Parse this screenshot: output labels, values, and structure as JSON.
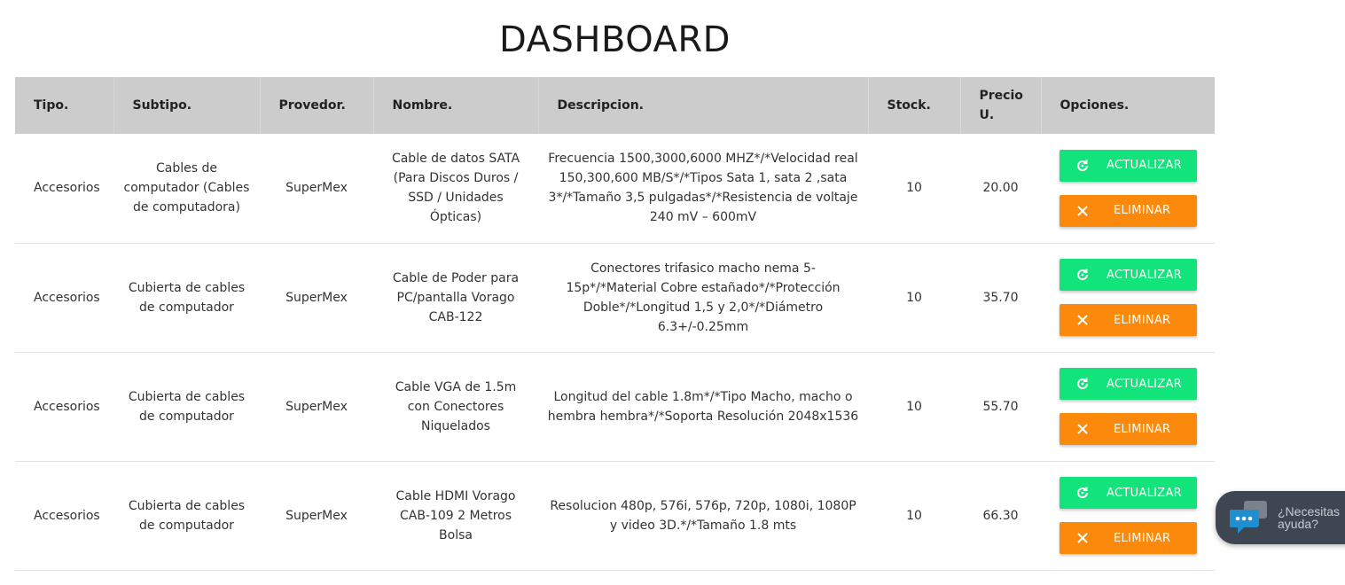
{
  "page": {
    "title": "DASHBOARD"
  },
  "table": {
    "headers": {
      "tipo": "Tipo.",
      "subtipo": "Subtipo.",
      "proveedor": "Provedor.",
      "nombre": "Nombre.",
      "descripcion": "Descripcion.",
      "stock": "Stock.",
      "precio": "Precio U.",
      "opciones": "Opciones."
    },
    "rows": [
      {
        "tipo": "Accesorios",
        "subtipo": "Cables de computador (Cables de computadora)",
        "proveedor": "SuperMex",
        "nombre": "Cable de datos SATA (Para Discos Duros / SSD / Unidades Ópticas)",
        "descripcion": "Frecuencia 1500,3000,6000 MHZ*/*Velocidad real 150,300,600 MB/S*/*Tipos Sata 1, sata 2 ,sata 3*/*Tamaño 3,5 pulgadas*/*Resistencia de voltaje 240 mV – 600mV",
        "stock": "10",
        "precio": "20.00"
      },
      {
        "tipo": "Accesorios",
        "subtipo": "Cubierta de cables de computador",
        "proveedor": "SuperMex",
        "nombre": "Cable de Poder para PC/pantalla Vorago CAB-122",
        "descripcion": "Conectores trifasico macho nema 5-15p*/*Material Cobre estañado*/*Protección Doble*/*Longitud 1,5 y 2,0*/*Diámetro 6.3+/-0.25mm",
        "stock": "10",
        "precio": "35.70"
      },
      {
        "tipo": "Accesorios",
        "subtipo": "Cubierta de cables de computador",
        "proveedor": "SuperMex",
        "nombre": "Cable VGA de 1.5m con Conectores Niquelados",
        "descripcion": "Longitud del cable 1.8m*/*Tipo Macho, macho o hembra hembra*/*Soporta Resolución 2048x1536",
        "stock": "10",
        "precio": "55.70"
      },
      {
        "tipo": "Accesorios",
        "subtipo": "Cubierta de cables de computador",
        "proveedor": "SuperMex",
        "nombre": "Cable HDMI Vorago CAB-109 2 Metros Bolsa",
        "descripcion": "Resolucion 480p, 576i, 576p, 720p, 1080i, 1080P y video 3D.*/*Tamaño 1.8 mts",
        "stock": "10",
        "precio": "66.30"
      }
    ]
  },
  "actions": {
    "update_label": "ACTUALIZAR",
    "update_icon": "refresh-icon",
    "delete_label": "ELIMINAR",
    "delete_icon": "close-icon"
  },
  "chat": {
    "text": "¿Necesitas ayuda?",
    "icon": "chat-bubbles-icon"
  },
  "colors": {
    "header_bg": "#cccccc",
    "update_button": "#12e37a",
    "delete_button": "#fb8a0c",
    "chat_bg": "#3d4651",
    "chat_icon": "#1f8fd0"
  }
}
